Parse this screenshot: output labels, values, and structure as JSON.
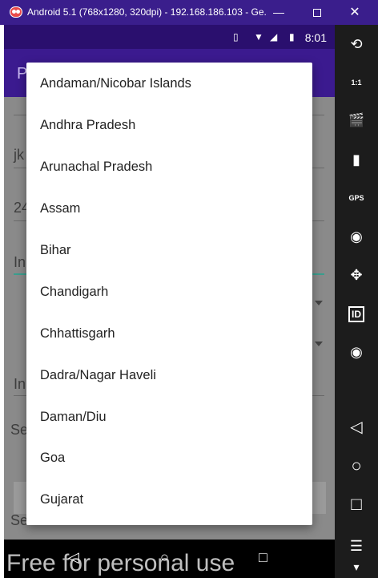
{
  "window": {
    "title": "Android 5.1 (768x1280, 320dpi) - 192.168.186.103 - Ge...",
    "minimize_glyph": "—",
    "close_glyph": "✕"
  },
  "status_bar": {
    "time": "8:01",
    "icons": [
      "vibrate-icon",
      "wifi-icon",
      "signal-icon",
      "battery-icon"
    ]
  },
  "app": {
    "title_fragment": "P",
    "background_fields": [
      "jk",
      "24",
      "In",
      "In"
    ],
    "background_labels": [
      "Se",
      "Se"
    ]
  },
  "dropdown": {
    "options": [
      "Andaman/Nicobar Islands",
      "Andhra Pradesh",
      "Arunachal Pradesh",
      "Assam",
      "Bihar",
      "Chandigarh",
      "Chhattisgarh",
      "Dadra/Nagar Haveli",
      "Daman/Diu",
      "Goa",
      "Gujarat"
    ]
  },
  "nav_bar": {
    "back_glyph": "◁",
    "home_glyph": "○",
    "recents_glyph": "□"
  },
  "watermark": "Free for personal use",
  "emulator_toolbar": {
    "items": [
      {
        "name": "rotate-icon",
        "glyph": "⟲"
      },
      {
        "name": "pixel-perfect-icon",
        "glyph": "1:1"
      },
      {
        "name": "screencast-icon",
        "glyph": "🎬"
      },
      {
        "name": "battery-widget-icon",
        "glyph": "▮"
      },
      {
        "name": "gps-icon",
        "glyph": "GPS"
      },
      {
        "name": "camera-icon",
        "glyph": "◉"
      },
      {
        "name": "dpad-icon",
        "glyph": "✥"
      },
      {
        "name": "device-id-icon",
        "glyph": "ID"
      },
      {
        "name": "media-icon",
        "glyph": "◉"
      },
      {
        "name": "back-button",
        "glyph": "◁"
      },
      {
        "name": "home-button",
        "glyph": "○"
      },
      {
        "name": "recents-button",
        "glyph": "□"
      },
      {
        "name": "menu-button",
        "glyph": "☰"
      },
      {
        "name": "more-button",
        "glyph": "▾"
      }
    ]
  }
}
